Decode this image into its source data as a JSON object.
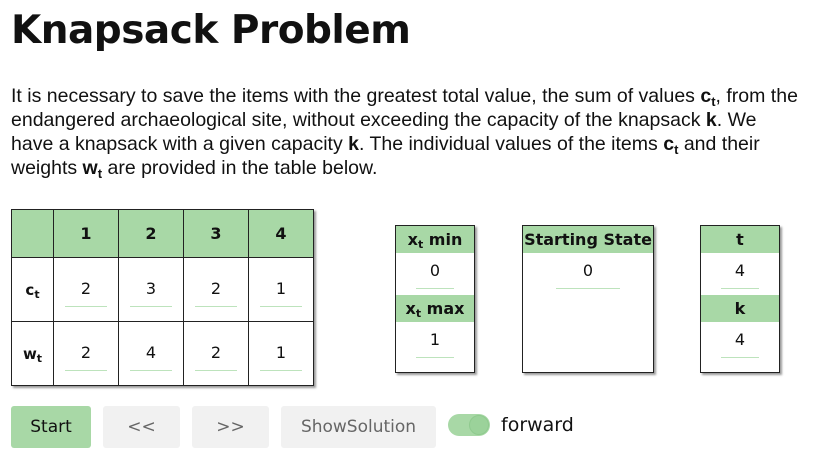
{
  "page_title": "Knapsack Problem",
  "description": {
    "p1": "It is necessary to save the items with the greatest total value, the sum of values ",
    "c": "c",
    "t": "t",
    "p2": ", from the endangered archaeological site, without exceeding the capacity of the knapsack ",
    "k": "k",
    "p3": ". We have a knapsack with a given capacity ",
    "p4": ". The individual values of the items ",
    "p5": " and their weights ",
    "w": "w",
    "p6": " are provided in the table below."
  },
  "table": {
    "columns": [
      "1",
      "2",
      "3",
      "4"
    ],
    "row_c_label": "c",
    "row_w_label": "w",
    "sub_t": "t",
    "c_values": [
      "2",
      "3",
      "2",
      "1"
    ],
    "w_values": [
      "2",
      "4",
      "2",
      "1"
    ]
  },
  "xbox": {
    "min_label_x": "x",
    "min_label_sub": "t",
    "min_label_rest": " min",
    "min_value": "0",
    "max_label_x": "x",
    "max_label_sub": "t",
    "max_label_rest": " max",
    "max_value": "1"
  },
  "state_box": {
    "label": "Starting State",
    "value": "0"
  },
  "tk_box": {
    "t_label": "t",
    "t_value": "4",
    "k_label": "k",
    "k_value": "4"
  },
  "controls": {
    "start": "Start",
    "back": "<<",
    "forward_btn": ">>",
    "show_solution": "ShowSolution",
    "toggle_label": "forward",
    "toggle_on": true
  },
  "colors": {
    "accent": "#a8d8a6",
    "ghost": "#f1f1f1"
  }
}
